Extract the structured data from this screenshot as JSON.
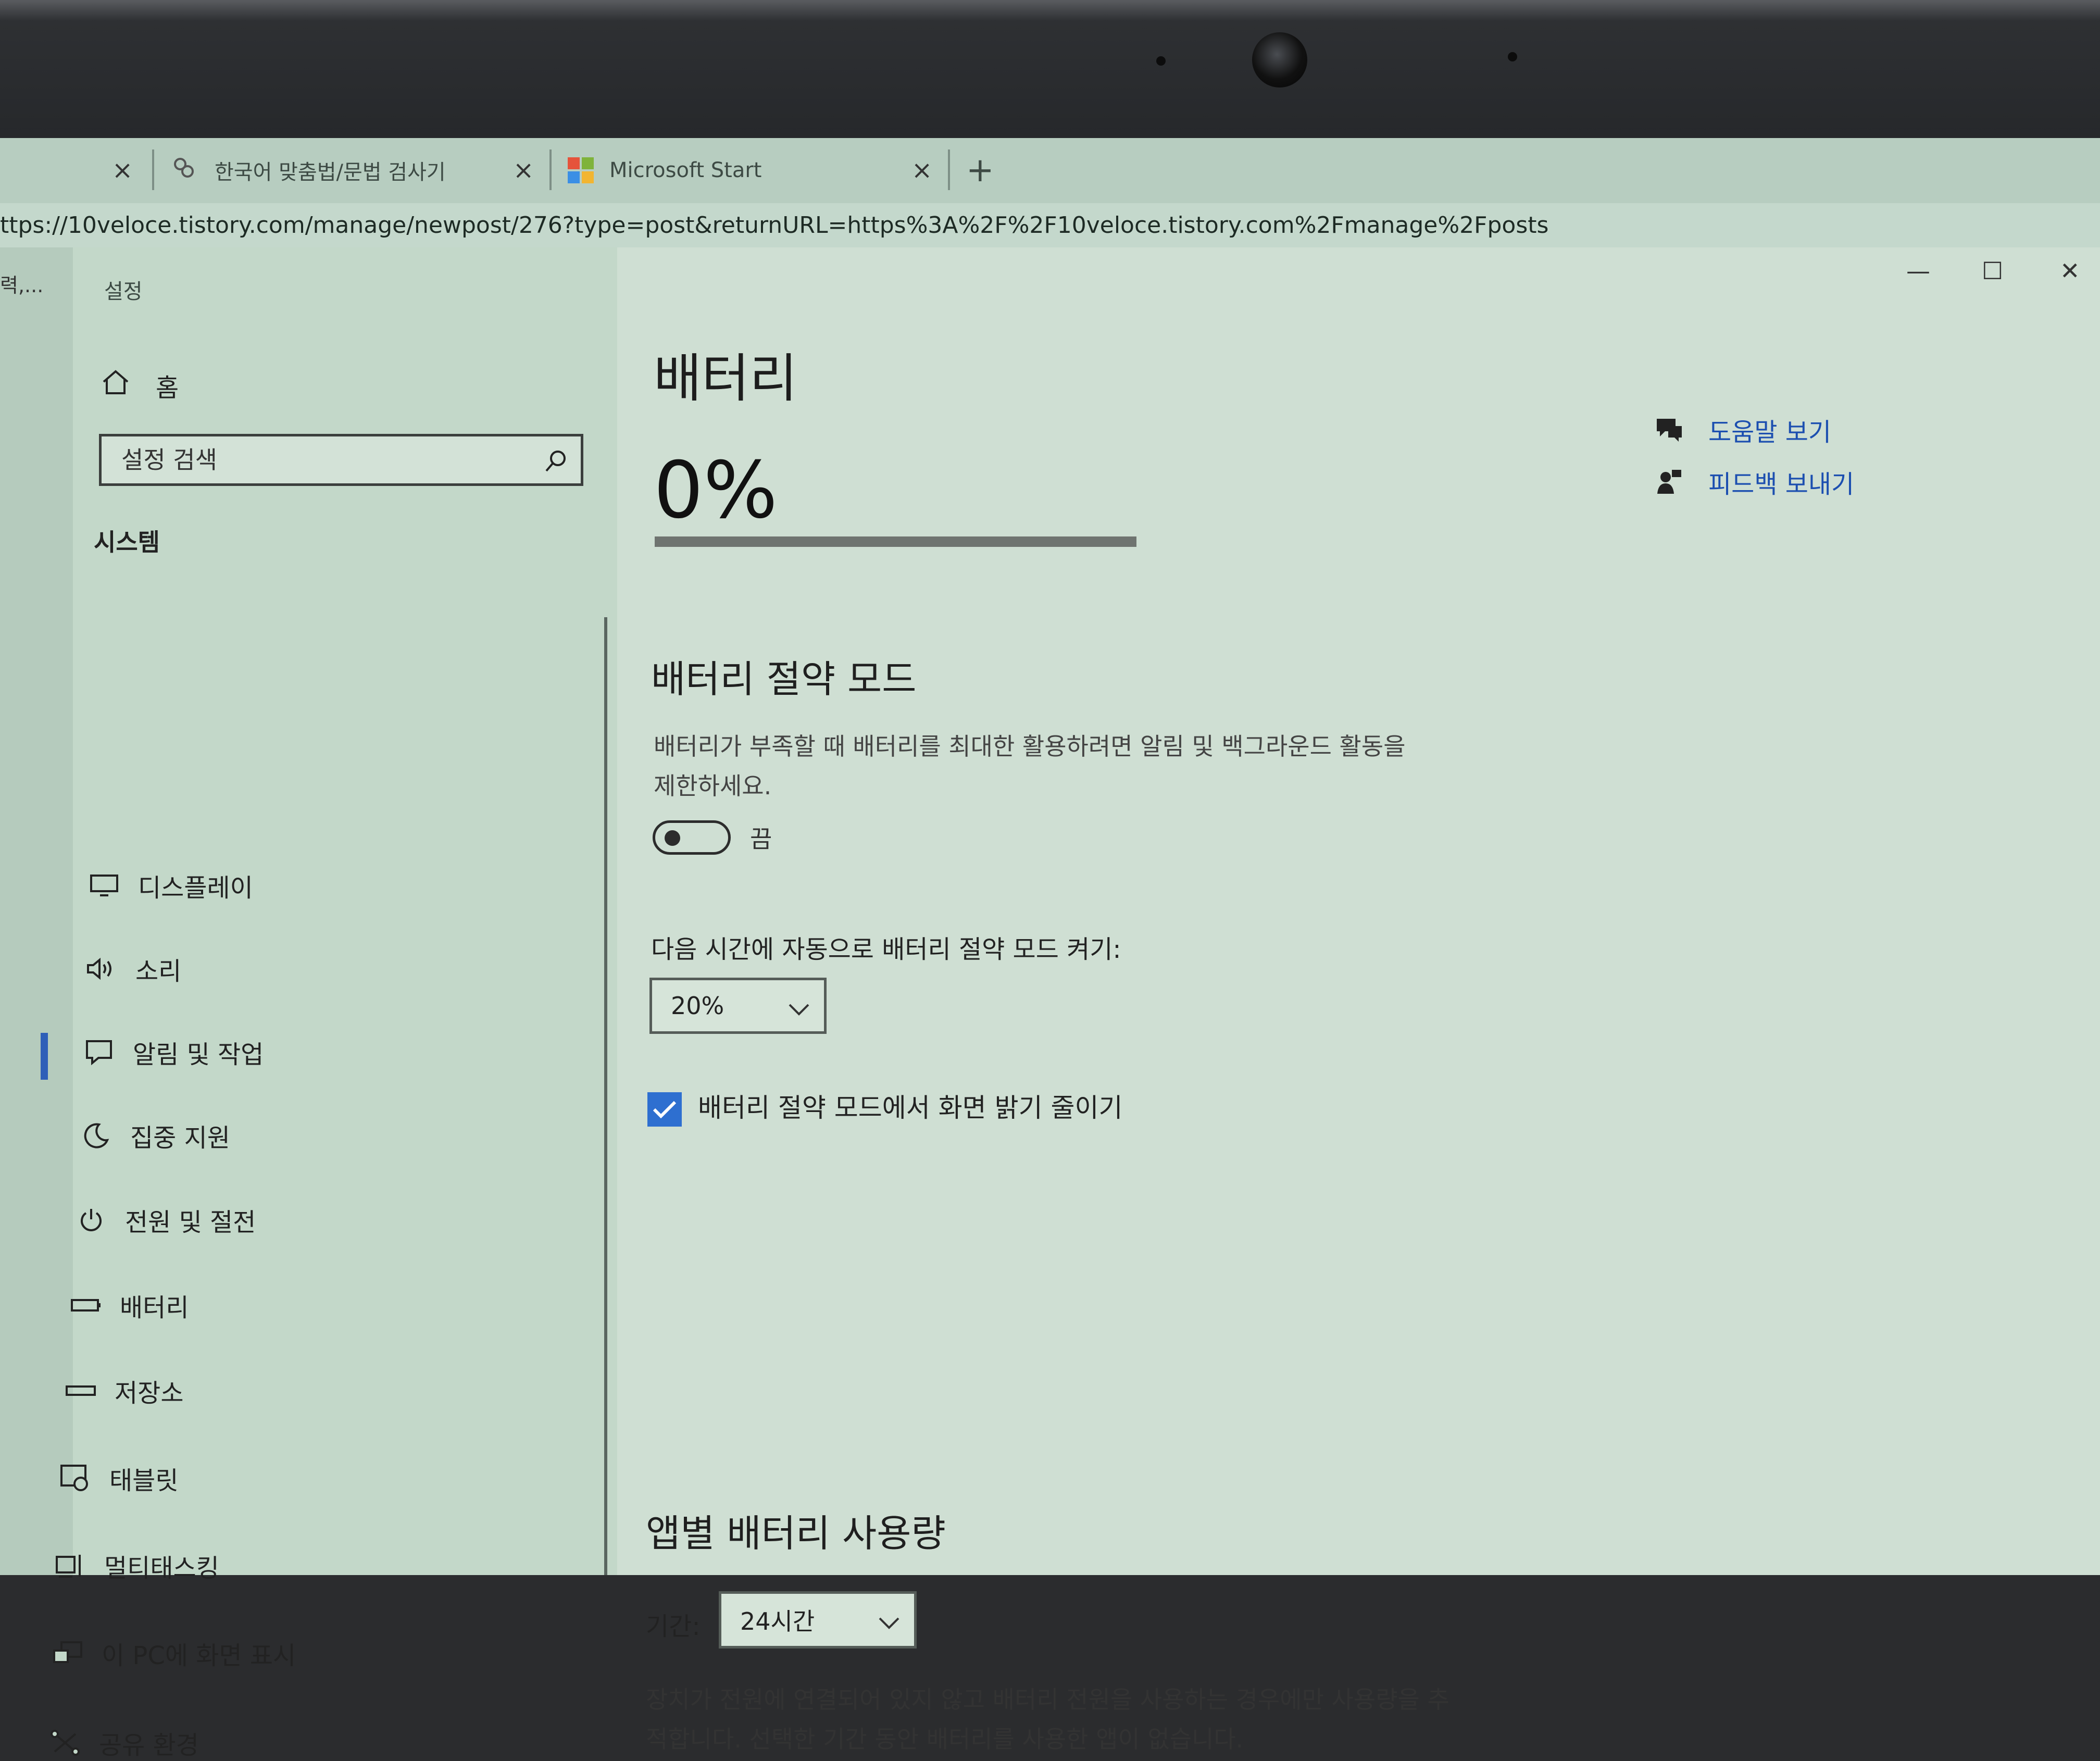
{
  "browser": {
    "tabs": [
      {
        "title": ""
      },
      {
        "title": "한국어 맞춤법/문법 검사기"
      },
      {
        "title": "Microsoft Start"
      }
    ],
    "new_tab_label": "+",
    "close_glyph": "×",
    "url": "ttps://10veloce.tistory.com/manage/newpost/276?type=post&returnURL=https%3A%2F%2F10veloce.tistory.com%2Fmanage%2Fposts",
    "side_text": "력,..."
  },
  "window": {
    "title": "설정",
    "controls": {
      "minimize": "—",
      "maximize": "☐",
      "close": "✕"
    }
  },
  "sidebar": {
    "home": "홈",
    "search_placeholder": "설정 검색",
    "section": "시스템",
    "items": [
      {
        "label": "디스플레이",
        "icon": "monitor-icon"
      },
      {
        "label": "소리",
        "icon": "speaker-icon"
      },
      {
        "label": "알림 및 작업",
        "icon": "notification-icon"
      },
      {
        "label": "집중 지원",
        "icon": "moon-icon"
      },
      {
        "label": "전원 및 절전",
        "icon": "power-icon"
      },
      {
        "label": "배터리",
        "icon": "battery-icon",
        "active": true
      },
      {
        "label": "저장소",
        "icon": "storage-icon"
      },
      {
        "label": "태블릿",
        "icon": "tablet-icon"
      },
      {
        "label": "멀티태스킹",
        "icon": "multitasking-icon"
      },
      {
        "label": "이 PC에 화면 표시",
        "icon": "project-icon"
      },
      {
        "label": "공유 환경",
        "icon": "share-icon"
      }
    ]
  },
  "main": {
    "title": "배터리",
    "battery_percent": "0%",
    "battery_level": 0,
    "saver": {
      "heading": "배터리 절약 모드",
      "description": "배터리가 부족할 때 배터리를 최대한 활용하려면 알림 및 백그라운드 활동을 제한하세요.",
      "toggle_state": "끔",
      "auto_label": "다음 시간에 자동으로 배터리 절약 모드 켜기:",
      "auto_value": "20%",
      "dim_label": "배터리 절약 모드에서 화면 밝기 줄이기",
      "dim_checked": true
    },
    "usage": {
      "heading": "앱별 배터리 사용량",
      "period_label": "기간:",
      "period_value": "24시간",
      "note": "장치가 전원에 연결되어 있지 않고 배터리 전원을 사용하는 경우에만 사용량을 추적합니다. 선택한 기간 동안 배터리를 사용한 앱이 없습니다."
    },
    "links": [
      {
        "label": "도움말 보기",
        "icon": "help-icon"
      },
      {
        "label": "피드백 보내기",
        "icon": "feedback-icon"
      }
    ]
  },
  "colors": {
    "accent": "#2e6fd0",
    "link": "#1c4fb0"
  }
}
